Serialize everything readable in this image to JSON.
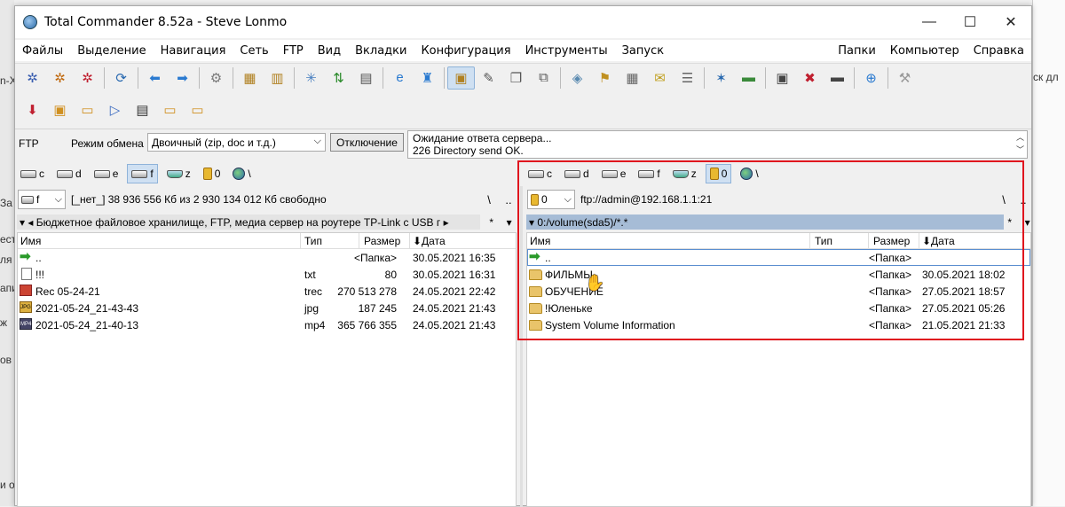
{
  "background": {
    "left_fragments": [
      "n-X",
      "За",
      "ест",
      "ля",
      "апи",
      "ж",
      "ов",
      "и ол"
    ],
    "right_fragments": [
      "ск дл"
    ]
  },
  "window": {
    "title": "Total Commander 8.52a - Steve Lonmo",
    "controls": {
      "minimize": "—",
      "maximize": "☐",
      "close": "✕"
    }
  },
  "menu": {
    "left": [
      "Файлы",
      "Выделение",
      "Навигация",
      "Сеть",
      "FTP",
      "Вид",
      "Вкладки",
      "Конфигурация",
      "Инструменты",
      "Запуск"
    ],
    "right": [
      "Папки",
      "Компьютер",
      "Справка"
    ]
  },
  "ftp": {
    "label": "FTP",
    "mode_label": "Режим обмена",
    "mode_value": "Двоичный (zip, doc и т.д.)",
    "disconnect": "Отключение",
    "log_line1": "Ожидание ответа сервера...",
    "log_line2": "226 Directory send OK."
  },
  "left_panel": {
    "drives": [
      {
        "letter": "c",
        "type": "hdd",
        "selected": false
      },
      {
        "letter": "d",
        "type": "hdd",
        "selected": false
      },
      {
        "letter": "e",
        "type": "hdd",
        "selected": false
      },
      {
        "letter": "f",
        "type": "hdd",
        "selected": true
      },
      {
        "letter": "z",
        "type": "net",
        "selected": false
      },
      {
        "letter": "0",
        "type": "usb",
        "selected": false
      },
      {
        "letter": "\\",
        "type": "globe",
        "selected": false
      }
    ],
    "drive_select": "f",
    "free_space": "[_нет_]  38 936 556 Кб из 2 930 134 012 Кб свободно",
    "path_buttons": [
      "\\",
      ".."
    ],
    "current_path": "▾ ◂ Бюджетное файловое хранилище, FTP, медиа сервер на роутере TP-Link с USB г ▸",
    "path_tail": [
      "*",
      "▾"
    ],
    "columns": {
      "name": "Имя",
      "type": "Тип",
      "size": "Размер",
      "date": "⬇Дата"
    },
    "rows": [
      {
        "icon": "up",
        "name": "..",
        "type": "",
        "size": "<Папка>",
        "date": "30.05.2021 16:35"
      },
      {
        "icon": "doc",
        "name": "!!!",
        "type": "txt",
        "size": "80",
        "date": "30.05.2021 16:31"
      },
      {
        "icon": "rec",
        "name": "Rec 05-24-21",
        "type": "trec",
        "size": "270 513 278",
        "date": "24.05.2021 22:42"
      },
      {
        "icon": "jpg",
        "name": "2021-05-24_21-43-43",
        "type": "jpg",
        "size": "187 245",
        "date": "24.05.2021 21:43"
      },
      {
        "icon": "mp4",
        "name": "2021-05-24_21-40-13",
        "type": "mp4",
        "size": "365 766 355",
        "date": "24.05.2021 21:43"
      }
    ]
  },
  "right_panel": {
    "drives": [
      {
        "letter": "c",
        "type": "hdd",
        "selected": false
      },
      {
        "letter": "d",
        "type": "hdd",
        "selected": false
      },
      {
        "letter": "e",
        "type": "hdd",
        "selected": false
      },
      {
        "letter": "f",
        "type": "hdd",
        "selected": false
      },
      {
        "letter": "z",
        "type": "net",
        "selected": false
      },
      {
        "letter": "0",
        "type": "usb",
        "selected": true
      },
      {
        "letter": "\\",
        "type": "globe",
        "selected": false
      }
    ],
    "drive_select": "0",
    "free_space": "ftp://admin@192.168.1.1:21",
    "path_buttons": [
      "\\",
      ".."
    ],
    "current_path": "▾ 0:/volume(sda5)/*.*",
    "path_tail": [
      "*",
      "▾"
    ],
    "columns": {
      "name": "Имя",
      "type": "Тип",
      "size": "Размер",
      "date": "⬇Дата"
    },
    "rows": [
      {
        "icon": "up",
        "name": "..",
        "type": "",
        "size": "<Папка>",
        "date": ""
      },
      {
        "icon": "folder",
        "name": "ФИЛЬМЫ",
        "type": "",
        "size": "<Папка>",
        "date": "30.05.2021 18:02"
      },
      {
        "icon": "folder",
        "name": "ОБУЧЕНИЕ",
        "type": "",
        "size": "<Папка>",
        "date": "27.05.2021 18:57"
      },
      {
        "icon": "folder",
        "name": "!Юленьке",
        "type": "",
        "size": "<Папка>",
        "date": "27.05.2021 05:26"
      },
      {
        "icon": "folder",
        "name": "System Volume Information",
        "type": "",
        "size": "<Папка>",
        "date": "21.05.2021 21:33"
      }
    ]
  },
  "toolbar1": [
    {
      "name": "settings-blue-icon",
      "glyph": "✲",
      "color": "#3b5fb0"
    },
    {
      "name": "settings-orange-icon",
      "glyph": "✲",
      "color": "#c06a10"
    },
    {
      "name": "settings-red-icon",
      "glyph": "✲",
      "color": "#c02030"
    },
    {
      "sep": true
    },
    {
      "name": "refresh-icon",
      "glyph": "⟳",
      "color": "#2a6ab0"
    },
    {
      "sep": true
    },
    {
      "name": "back-icon",
      "glyph": "⬅",
      "color": "#2a7ad0"
    },
    {
      "name": "forward-icon",
      "glyph": "➡",
      "color": "#2a7ad0"
    },
    {
      "sep": true
    },
    {
      "name": "gear-icon",
      "glyph": "⚙",
      "color": "#777"
    },
    {
      "sep": true
    },
    {
      "name": "pack-icon",
      "glyph": "▦",
      "color": "#b08020"
    },
    {
      "name": "unpack-icon",
      "glyph": "▥",
      "color": "#b08020"
    },
    {
      "sep": true
    },
    {
      "name": "select-icon",
      "glyph": "✳",
      "color": "#4a80c0"
    },
    {
      "name": "sort-icon",
      "glyph": "⇅",
      "color": "#2a8a2a"
    },
    {
      "name": "clipboard-icon",
      "glyph": "▤",
      "color": "#555"
    },
    {
      "sep": true
    },
    {
      "name": "browser-icon",
      "glyph": "e",
      "color": "#2a7ad0"
    },
    {
      "name": "network-icon",
      "glyph": "♜",
      "color": "#2a7ad0"
    },
    {
      "sep": true
    },
    {
      "name": "view-file-icon",
      "glyph": "▣",
      "color": "#b08020",
      "active": true
    },
    {
      "name": "edit-file-icon",
      "glyph": "✎",
      "color": "#555"
    },
    {
      "name": "copy-file-icon",
      "glyph": "❐",
      "color": "#555"
    },
    {
      "name": "move-file-icon",
      "glyph": "⧉",
      "color": "#555"
    },
    {
      "sep": true
    },
    {
      "name": "disk-icon",
      "glyph": "◈",
      "color": "#5a8ab0"
    },
    {
      "name": "wand-icon",
      "glyph": "⚑",
      "color": "#c09020"
    },
    {
      "name": "calc-icon",
      "glyph": "▦",
      "color": "#666"
    },
    {
      "name": "notes-icon",
      "glyph": "✉",
      "color": "#c0a020"
    },
    {
      "name": "list-icon",
      "glyph": "☰",
      "color": "#666"
    },
    {
      "sep": true
    },
    {
      "name": "compare-icon",
      "glyph": "✶",
      "color": "#2a6ab0"
    },
    {
      "name": "sync-icon",
      "glyph": "▬",
      "color": "#3a8a3a"
    },
    {
      "sep": true
    },
    {
      "name": "monitor-icon",
      "glyph": "▣",
      "color": "#444"
    },
    {
      "name": "delete-icon",
      "glyph": "✖",
      "color": "#c02030"
    },
    {
      "name": "terminal-icon",
      "glyph": "▬",
      "color": "#444"
    },
    {
      "sep": true
    },
    {
      "name": "globe-icon",
      "glyph": "⊕",
      "color": "#2a7ad0"
    },
    {
      "sep": true
    },
    {
      "name": "tool-icon",
      "glyph": "⚒",
      "color": "#999"
    }
  ],
  "toolbar2": [
    {
      "name": "download-icon",
      "glyph": "⬇",
      "color": "#c02030"
    },
    {
      "name": "archive-icon",
      "glyph": "▣",
      "color": "#d09020"
    },
    {
      "name": "open-folder-icon",
      "glyph": "▭",
      "color": "#d09020"
    },
    {
      "name": "play-icon",
      "glyph": "▷",
      "color": "#3a6ac0"
    },
    {
      "name": "dos-icon",
      "glyph": "▤",
      "color": "#333"
    },
    {
      "name": "folder-icon",
      "glyph": "▭",
      "color": "#d09020"
    },
    {
      "name": "folder-alt-icon",
      "glyph": "▭",
      "color": "#d09020"
    }
  ]
}
